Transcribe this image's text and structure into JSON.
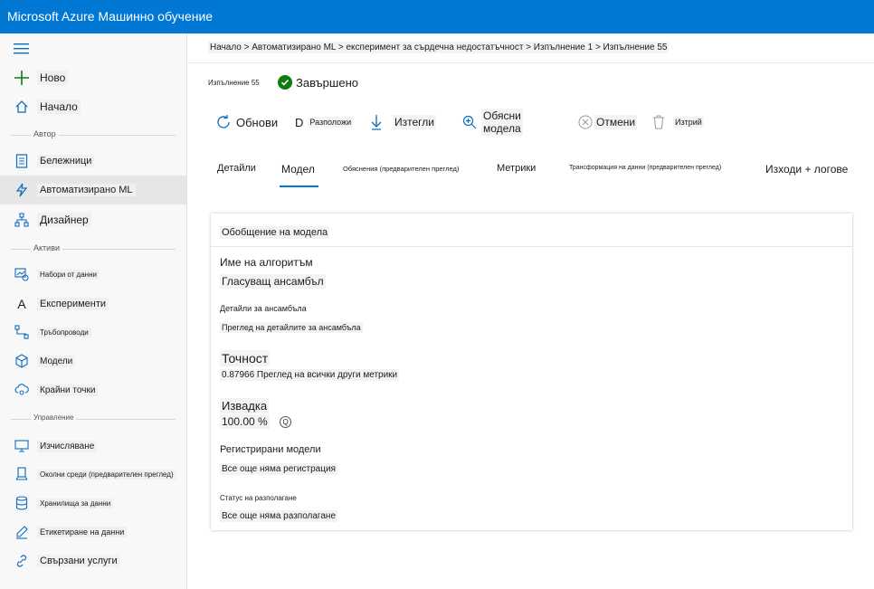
{
  "app": {
    "title": "Microsoft Azure Машинно обучение"
  },
  "sidebar": {
    "items": [
      {
        "label": "Ново",
        "icon": "plus-icon"
      },
      {
        "label": "Начало",
        "icon": "home-icon"
      },
      {
        "label": "Бележници",
        "icon": "notebook-icon"
      },
      {
        "label": "Автоматизирано ML",
        "icon": "lightning-icon"
      },
      {
        "label": "Дизайнер",
        "icon": "designer-icon"
      },
      {
        "label": "Набори от данни",
        "icon": "datasets-icon"
      },
      {
        "label": "Експерименти",
        "icon": "experiment-icon"
      },
      {
        "label": "Тръбопроводи",
        "icon": "pipeline-icon"
      },
      {
        "label": "Модели",
        "icon": "cube-icon"
      },
      {
        "label": "Крайни точки",
        "icon": "endpoint-icon"
      },
      {
        "label": "Изчисляване",
        "icon": "monitor-icon"
      },
      {
        "label": "Околни среди (предварителен преглед)",
        "icon": "environment-icon"
      },
      {
        "label": "Хранилища за данни",
        "icon": "database-icon"
      },
      {
        "label": "Етикетиране на данни",
        "icon": "edit-icon"
      },
      {
        "label": "Свързани услуги",
        "icon": "link-icon"
      }
    ],
    "sections": {
      "author": "Автор",
      "assets": "Активи",
      "manage": "Управление"
    }
  },
  "breadcrumb": "Начало > Автоматизирано ML > експеримент за сърдечна недостатъчност > Изпълнение 1 > Изпълнение 55",
  "run": {
    "name": "Изпълнение 55",
    "status": "Завършено"
  },
  "toolbar": {
    "refresh": "Обнови",
    "deploy": "Разположи",
    "download": "Изтегли",
    "explain": "Обясни модела",
    "cancel": "Отмени",
    "delete": "Изтрий"
  },
  "tabs": [
    "Детайли",
    "Модел",
    "Обяснения (предварителен преглед)",
    "Метрики",
    "Трансформация на данни (предварителен преглед)",
    "Изходи + логове"
  ],
  "card": {
    "title": "Обобщение на модела",
    "algorithm_label": "Име на алгоритъм",
    "algorithm_value": "Гласуващ ансамбъл",
    "ensemble_label": "Детайли за ансамбъла",
    "ensemble_link": "Преглед на детайлите за ансамбъла",
    "accuracy_label": "Точност",
    "accuracy_value": "0.87966 Преглед на всички други метрики",
    "sampling_label": "Извадка",
    "sampling_value": "100.00 %",
    "registered_label": "Регистрирани модели",
    "registered_value": "Все още няма регистрация",
    "deploy_status_label": "Статус на разполагане",
    "deploy_status_value": "Все още няма разполагане"
  },
  "colors": {
    "accent": "#0078d4",
    "success": "#107c10"
  }
}
